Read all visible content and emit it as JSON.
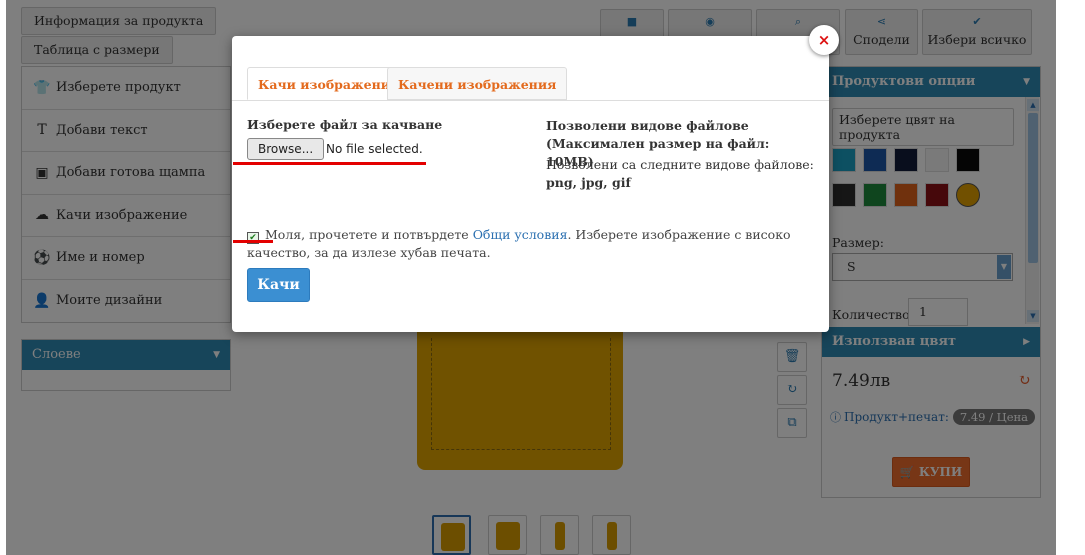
{
  "top_tabs": {
    "product_info": "Информация за продукта",
    "size_table": "Таблица с размери"
  },
  "toolbar": {
    "save_icon": "save-icon",
    "preview_icon": "eye-icon",
    "zoom_icon": "search-icon",
    "share_label": "Сподели",
    "select_all_label": "Избери всичко"
  },
  "left_menu": {
    "items": [
      {
        "label": "Изберете продукт",
        "icon": "tshirt-icon"
      },
      {
        "label": "Добави текст",
        "icon": "text-icon"
      },
      {
        "label": "Добави готова щампа",
        "icon": "image-icon"
      },
      {
        "label": "Качи изображение",
        "icon": "upload-cloud-icon"
      },
      {
        "label": "Име и номер",
        "icon": "soccer-ball-icon"
      },
      {
        "label": "Моите дизайни",
        "icon": "user-icon"
      }
    ],
    "layers_label": "Слоеве"
  },
  "right_panel": {
    "options_title": "Продуктови опции",
    "color_placeholder": "Изберете цвят на продукта",
    "swatches": [
      "#1aa0c4",
      "#1c56a8",
      "#131c3a",
      "#f4f4f4",
      "#0a0a0a",
      "#2c2c2c",
      "#1f8a3d",
      "#e0621a",
      "#8c1116",
      "#e2a000"
    ],
    "size_label": "Размер:",
    "size_value": "S",
    "qty_label": "Количество",
    "qty_value": "1",
    "used_color_title": "Използван цвят",
    "price": "7.49лв",
    "info_label": "Продукт+печат:",
    "info_badge": "7.49 / Цена",
    "buy_label": "КУПИ"
  },
  "modal": {
    "tab_upload": "Качи изображение",
    "tab_uploaded": "Качени изображения",
    "choose_file_title": "Изберете файл за качване",
    "browse_label": "Browse...",
    "no_file_label": "No file selected.",
    "allowed_title": "Позволени видове файлове (Максимален размер на файл: 10MB)",
    "allowed_text": "Позволени са следните видове файлове:",
    "allowed_types": "png, jpg, gif",
    "terms_prefix": "Моля, прочетете и потвърдете",
    "terms_link": "Общи условия",
    "terms_suffix": ". Изберете изображение с високо качество, за да излезе хубав печата.",
    "upload_button": "Качи",
    "close_label": "×"
  }
}
